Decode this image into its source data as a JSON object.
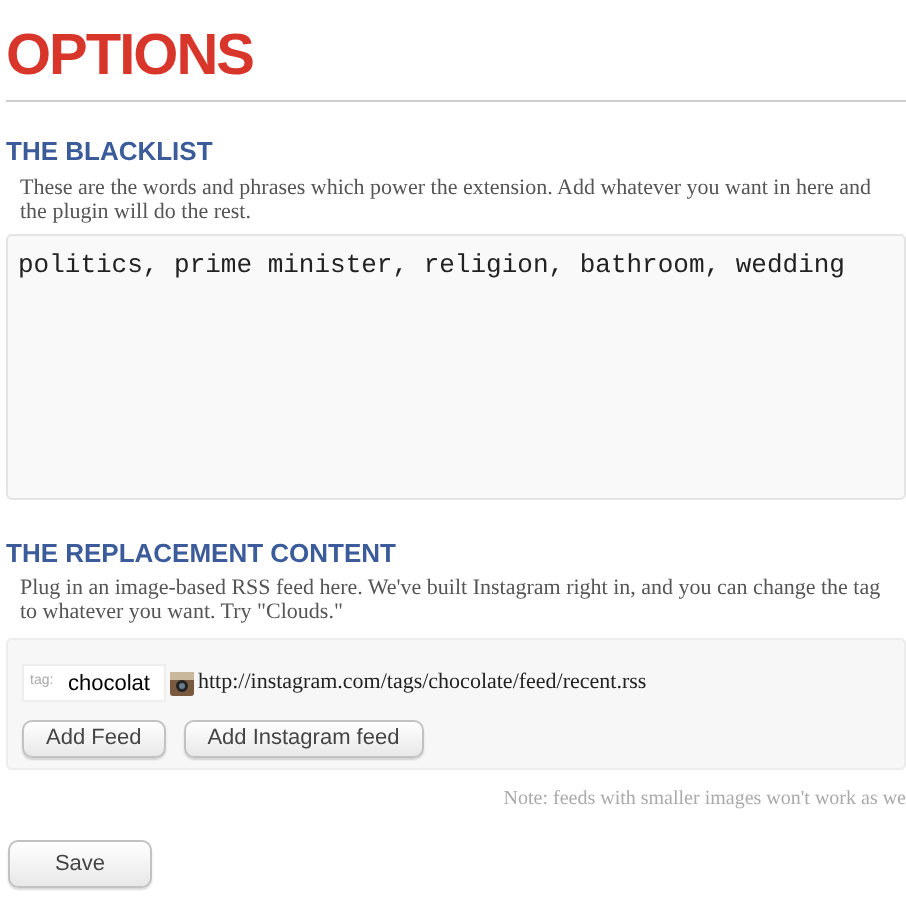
{
  "title": "OPTIONS",
  "blacklist": {
    "heading": "THE BLACKLIST",
    "description": "These are the words and phrases which power the extension. Add whatever you want in here and the plugin will do the rest.",
    "value": "politics, prime minister, religion, bathroom, wedding"
  },
  "replacement": {
    "heading": "THE REPLACEMENT CONTENT",
    "description": "Plug in an image-based RSS feed here. We've built Instagram right in, and you can change the tag to whatever you want. Try \"Clouds.\"",
    "feeds": [
      {
        "tag_label": "tag:",
        "tag_value": "chocolat",
        "url": "http://instagram.com/tags/chocolate/feed/recent.rss"
      }
    ],
    "buttons": [
      "Add Feed",
      "Add Instagram feed"
    ],
    "note": "Note: feeds with smaller images won't work as we"
  },
  "save_button": "Save"
}
